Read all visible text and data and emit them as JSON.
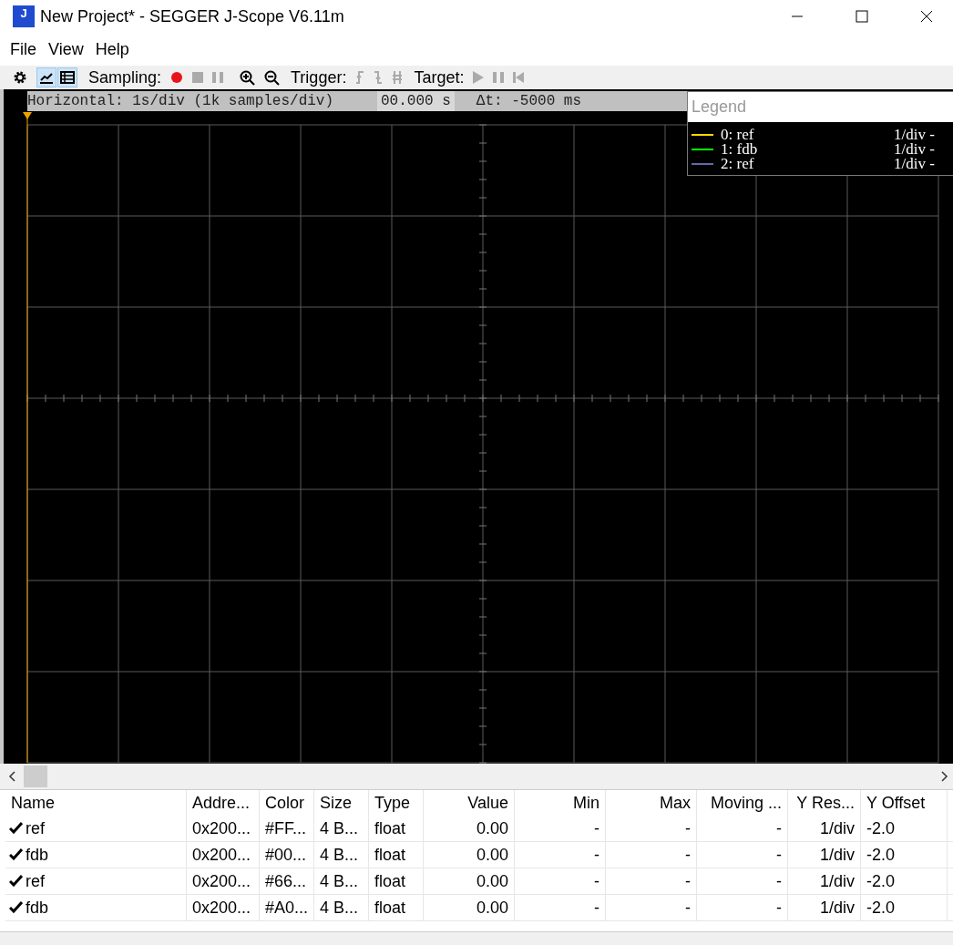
{
  "window": {
    "title": "New Project* - SEGGER J-Scope V6.11m",
    "logo": "J"
  },
  "menu": [
    "File",
    "View",
    "Help"
  ],
  "toolbar": {
    "view_buttons": [
      {
        "kind": "graph",
        "selected": true
      },
      {
        "kind": "table",
        "selected": true
      }
    ],
    "sampling_label": "Sampling:",
    "trigger_label": "Trigger:",
    "target_label": "Target:"
  },
  "horizontal_bar": {
    "scale": "Horizontal: 1s/div (1k samples/div)",
    "time": "00.000 s",
    "delta": "Δt: -5000 ms"
  },
  "legend": {
    "title": "Legend",
    "entries": [
      {
        "label": "0: ref",
        "scale": "1/div -",
        "color": "#ffd800"
      },
      {
        "label": "1: fdb",
        "scale": "1/div -",
        "color": "#00ff00"
      },
      {
        "label": "2: ref",
        "scale": "1/div -",
        "color": "#6666aa"
      }
    ]
  },
  "table": {
    "columns": [
      "Name",
      "Addre...",
      "Color",
      "Size",
      "Type",
      "Value",
      "Min",
      "Max",
      "Moving ...",
      "Y Res...",
      "Y Offset"
    ],
    "rows": [
      {
        "checked": true,
        "cells": [
          "ref",
          "0x200...",
          "#FF...",
          "4 B...",
          "float",
          "0.00",
          "-",
          "-",
          "-",
          "1/div",
          "-2.0"
        ]
      },
      {
        "checked": true,
        "cells": [
          "fdb",
          "0x200...",
          "#00...",
          "4 B...",
          "float",
          "0.00",
          "-",
          "-",
          "-",
          "1/div",
          "-2.0"
        ]
      },
      {
        "checked": true,
        "cells": [
          "ref",
          "0x200...",
          "#66...",
          "4 B...",
          "float",
          "0.00",
          "-",
          "-",
          "-",
          "1/div",
          "-2.0"
        ]
      },
      {
        "checked": true,
        "cells": [
          "fdb",
          "0x200...",
          "#A0...",
          "4 B...",
          "float",
          "0.00",
          "-",
          "-",
          "-",
          "1/div",
          "-2.0"
        ]
      }
    ]
  }
}
